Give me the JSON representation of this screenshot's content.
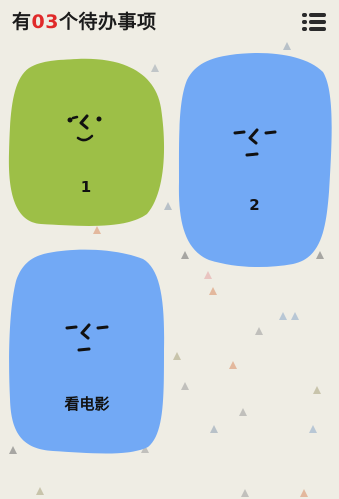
{
  "header": {
    "title_prefix": "有",
    "count": "03",
    "title_suffix": "个待办事项",
    "menu_icon": "list-menu-icon"
  },
  "colors": {
    "background": "#efede4",
    "count_red": "#e02a2a",
    "card_green": "#9dbf47",
    "card_blue": "#72a9f5"
  },
  "todos": [
    {
      "label": "1",
      "color": "#9dbf47",
      "face": "smiling-face-icon"
    },
    {
      "label": "2",
      "color": "#72a9f5",
      "face": "indifferent-face-icon"
    },
    {
      "label": "看电影",
      "color": "#72a9f5",
      "face": "indifferent-face-icon"
    }
  ]
}
